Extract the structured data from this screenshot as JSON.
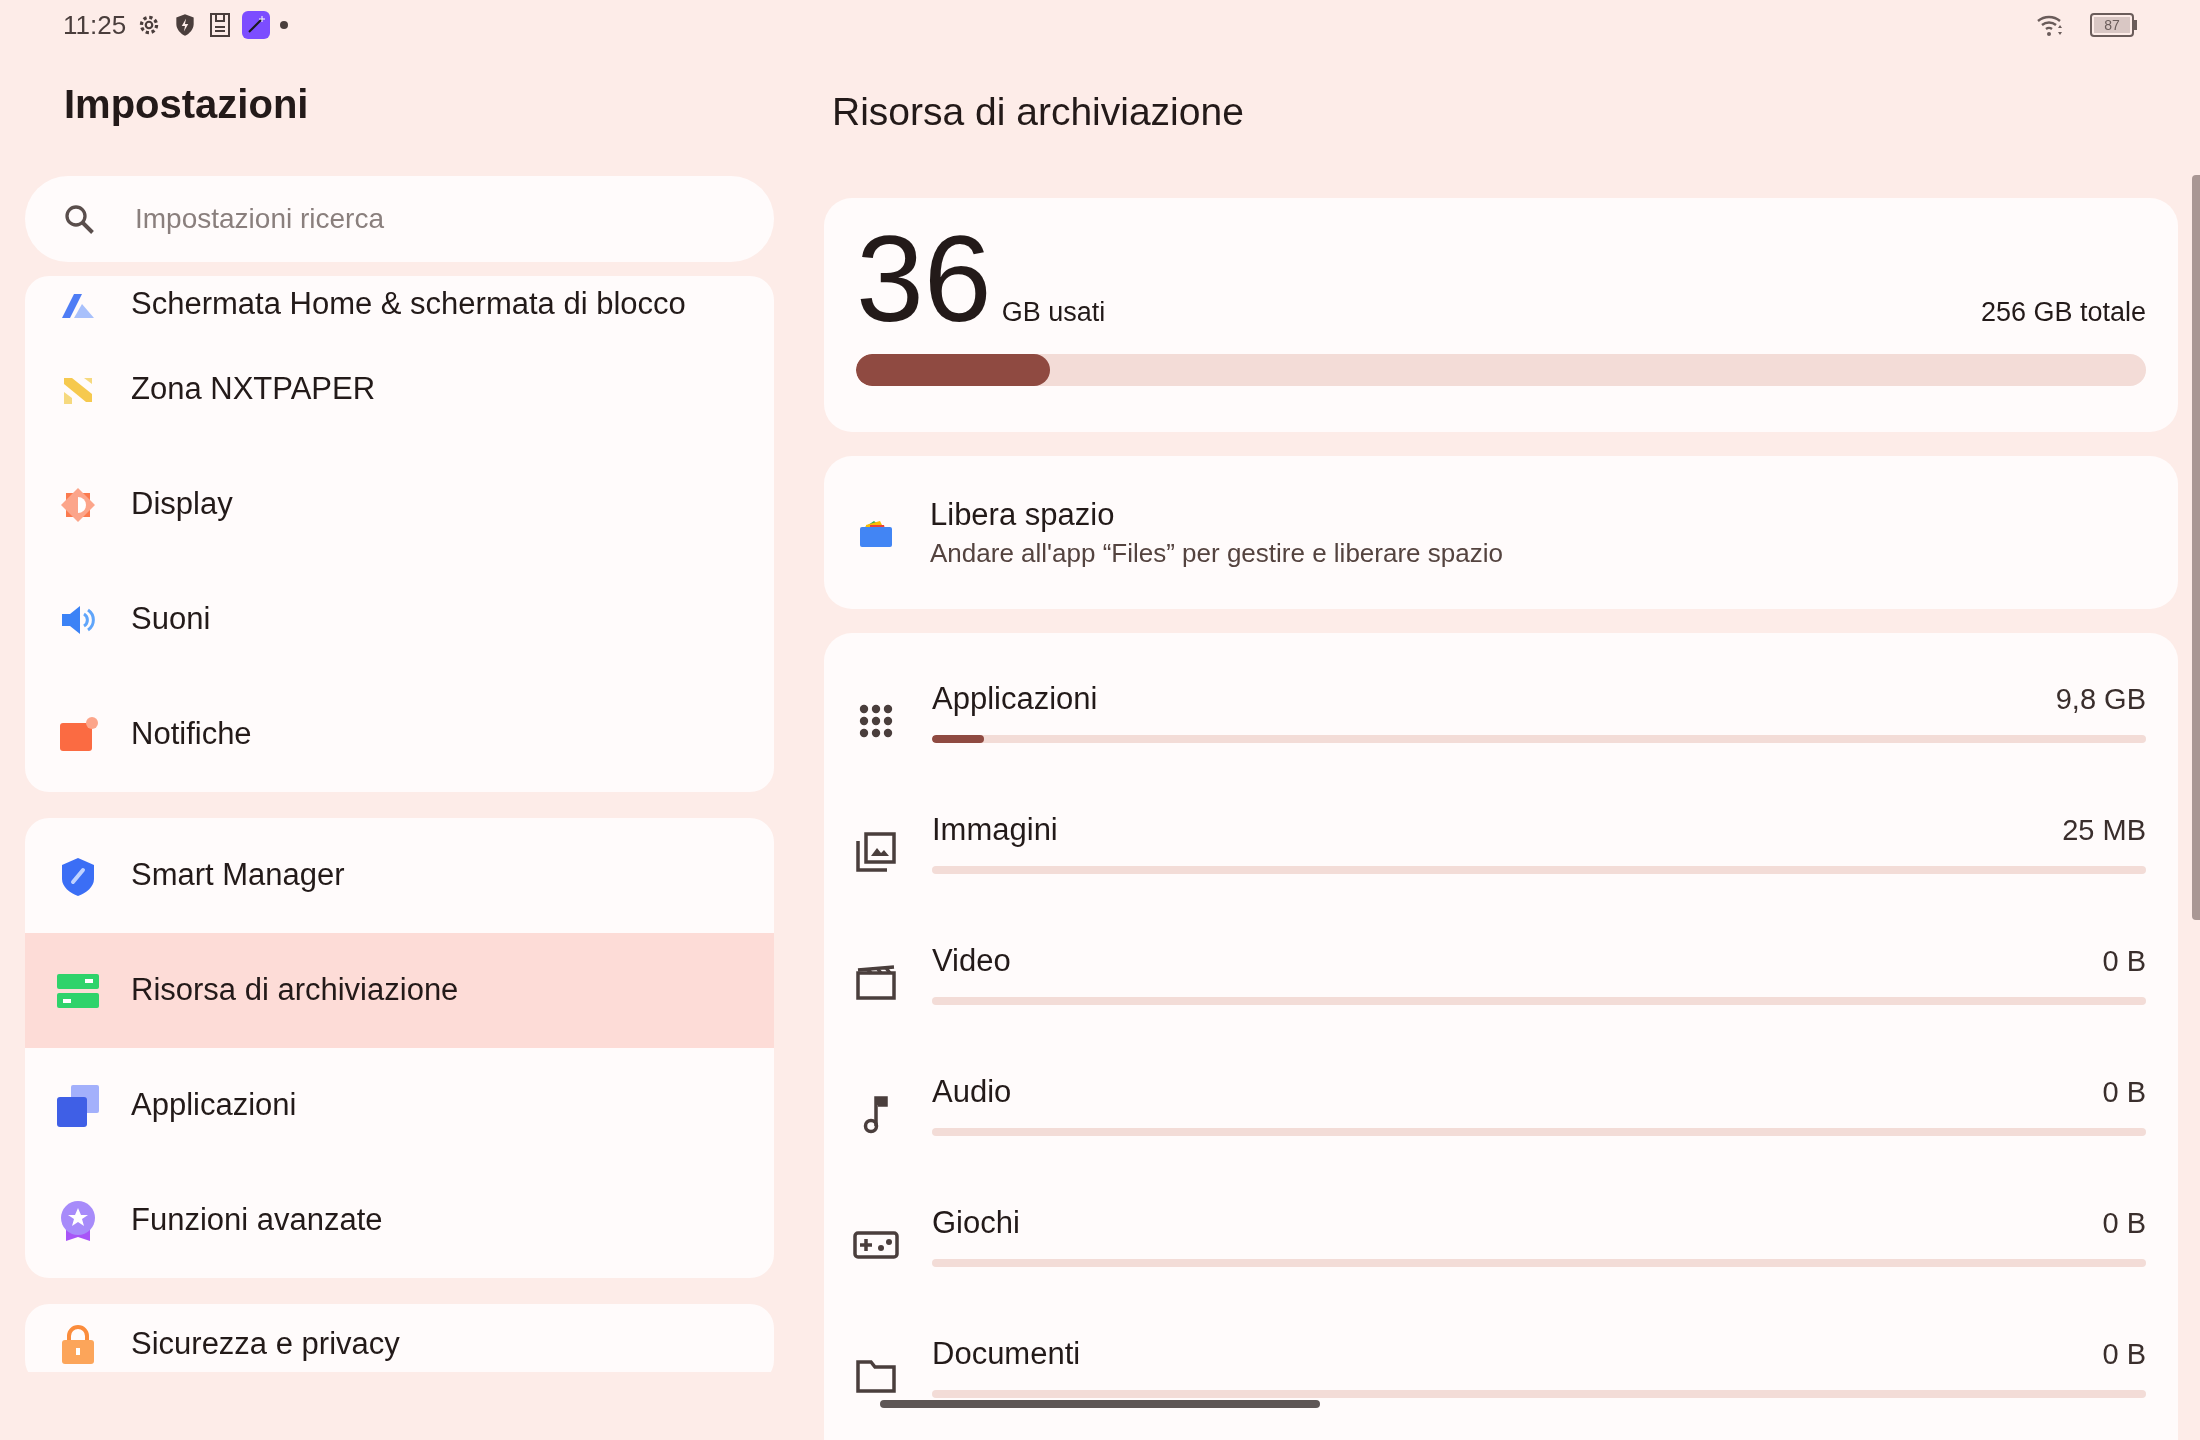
{
  "status_bar": {
    "time": "11:25",
    "battery": "87"
  },
  "sidebar": {
    "title": "Impostazioni",
    "search": {
      "placeholder": "Impostazioni ricerca"
    },
    "groups": [
      {
        "items": [
          {
            "label": "Schermata Home & schermata di blocco",
            "kind": "home",
            "selected": false
          },
          {
            "label": "Zona NXTPAPER",
            "kind": "paper",
            "selected": false
          },
          {
            "label": "Display",
            "kind": "display",
            "selected": false
          },
          {
            "label": "Suoni",
            "kind": "sound",
            "selected": false
          },
          {
            "label": "Notifiche",
            "kind": "notif",
            "selected": false
          }
        ]
      },
      {
        "items": [
          {
            "label": "Smart Manager",
            "kind": "shield",
            "selected": false
          },
          {
            "label": "Risorsa di archiviazione",
            "kind": "storage",
            "selected": true
          },
          {
            "label": "Applicazioni",
            "kind": "apps",
            "selected": false
          },
          {
            "label": "Funzioni avanzate",
            "kind": "badge",
            "selected": false
          }
        ]
      },
      {
        "items": [
          {
            "label": "Sicurezza e privacy",
            "kind": "lock",
            "selected": false
          }
        ]
      }
    ]
  },
  "detail": {
    "title": "Risorsa di archiviazione",
    "usage": {
      "used": "36",
      "used_unit": "GB usati",
      "total": "256 GB totale",
      "level": 0.15
    },
    "free_space": {
      "title": "Libera spazio",
      "subtitle": "Andare all'app “Files” per gestire e liberare spazio"
    },
    "categories": [
      {
        "label": "Applicazioni",
        "value": "9,8 GB",
        "kind": "grid",
        "level": 0.043
      },
      {
        "label": "Immagini",
        "value": "25 MB",
        "kind": "images",
        "level": 0
      },
      {
        "label": "Video",
        "value": "0 B",
        "kind": "video",
        "level": 0
      },
      {
        "label": "Audio",
        "value": "0 B",
        "kind": "audio",
        "level": 0
      },
      {
        "label": "Giochi",
        "value": "0 B",
        "kind": "games",
        "level": 0
      },
      {
        "label": "Documenti",
        "value": "0 B",
        "kind": "folder",
        "level": 0
      }
    ]
  }
}
